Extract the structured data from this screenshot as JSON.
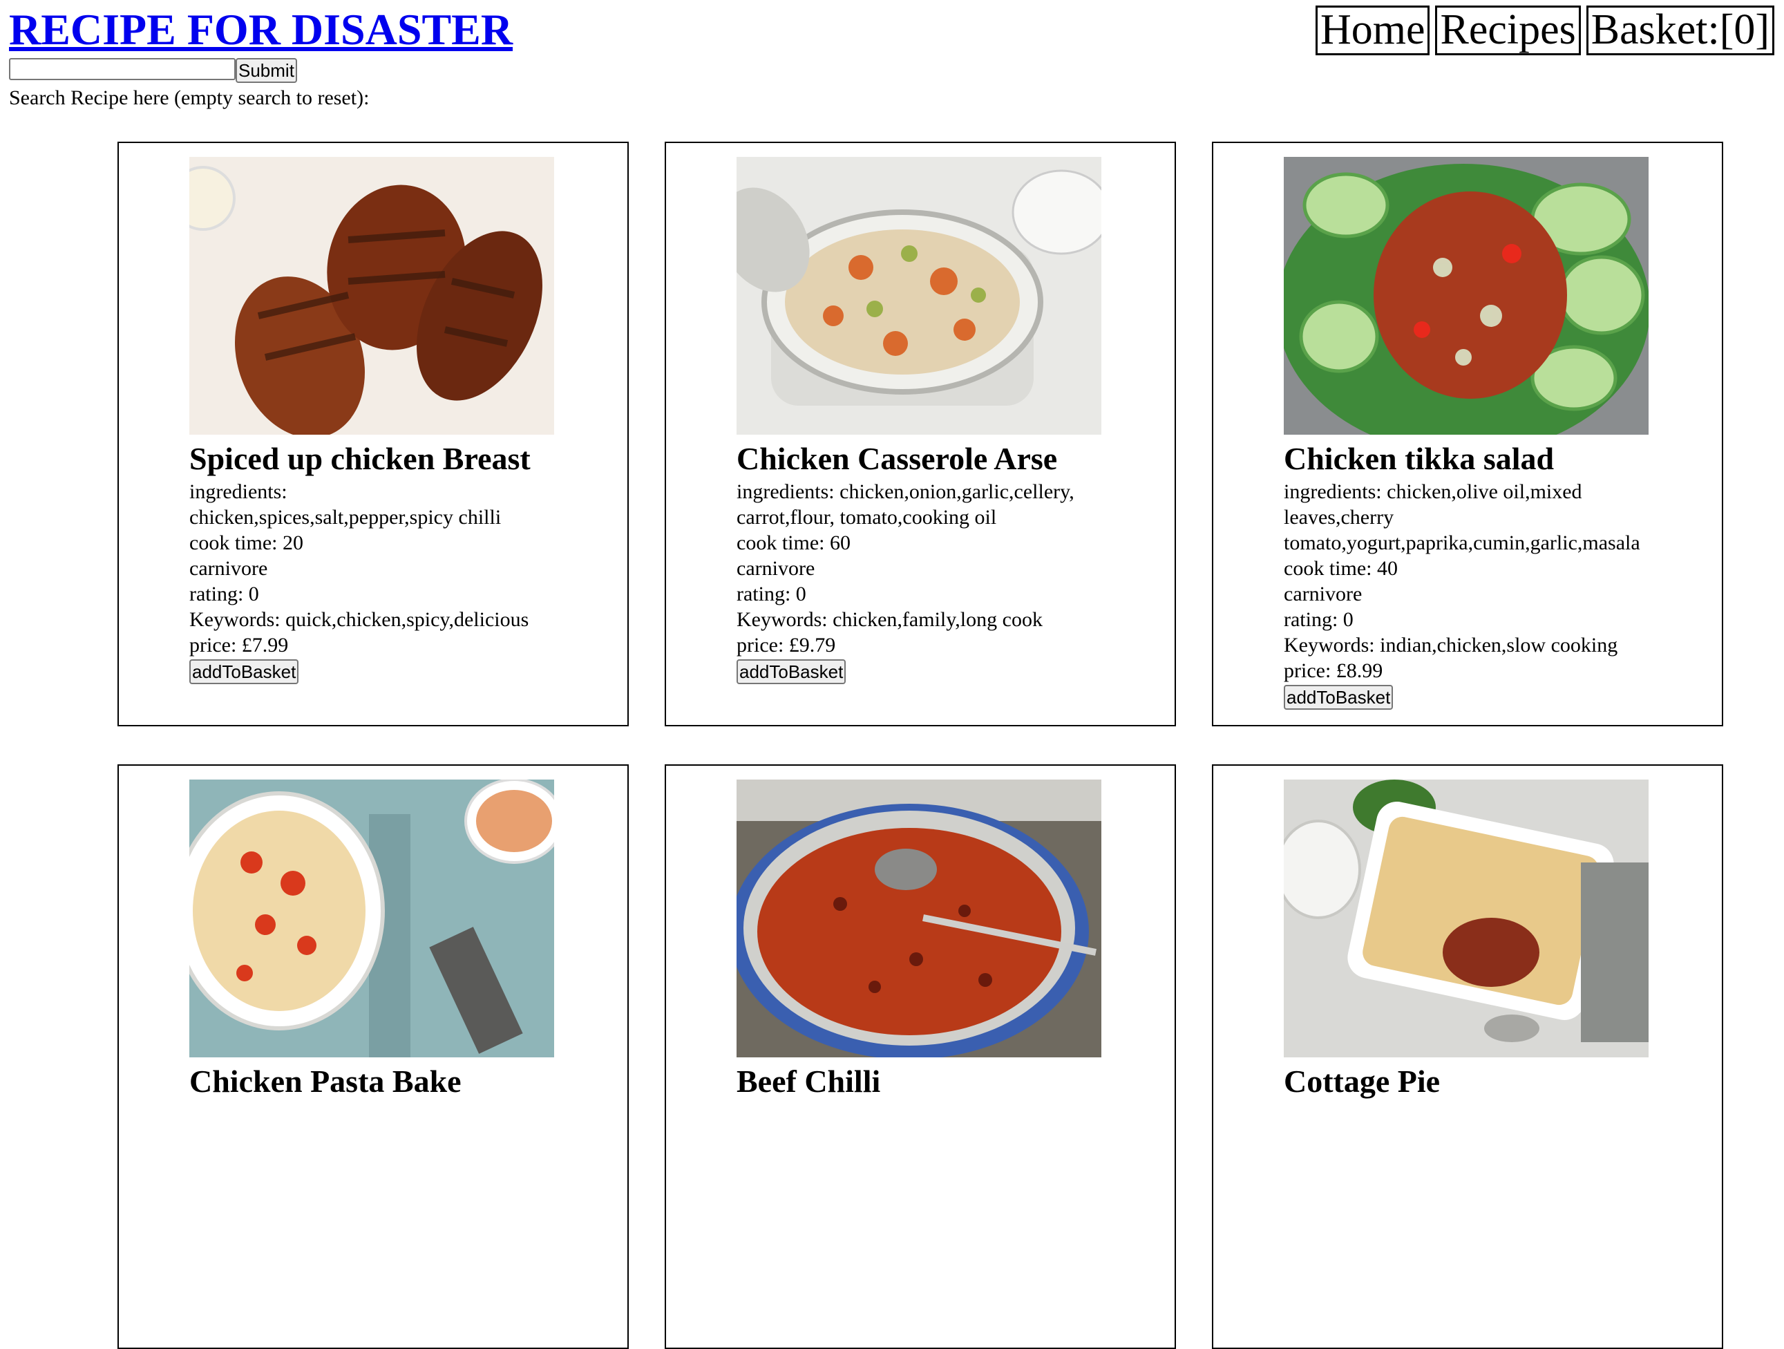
{
  "header": {
    "title": "RECIPE FOR DISASTER",
    "search": {
      "value": "",
      "placeholder": "",
      "submit_label": "Submit"
    },
    "search_hint": "Search Recipe here (empty search to reset):"
  },
  "nav": {
    "home": "Home",
    "recipes": "Recipes",
    "basket": "Basket:[0]"
  },
  "recipes": [
    {
      "name": "Spiced up chicken Breast",
      "ingredients": "ingredients: chicken,spices,salt,pepper,spicy chilli",
      "cook_time": "cook time: 20",
      "diet": "carnivore",
      "rating": "rating: 0",
      "keywords": "Keywords: quick,chicken,spicy,delicious",
      "price": "price: £7.99",
      "button_label": "addToBasket",
      "image": "grilled-chicken-breasts-photo",
      "image_colors": [
        "#f3ede6",
        "#8a3a18",
        "#3b1a0c"
      ]
    },
    {
      "name": "Chicken Casserole Arse",
      "ingredients": "ingredients: chicken,onion,garlic,cellery, carrot,flour, tomato,cooking oil",
      "cook_time": "cook time: 60",
      "diet": "carnivore",
      "rating": "rating: 0",
      "keywords": "Keywords: chicken,family,long cook",
      "price": "price: £9.79",
      "button_label": "addToBasket",
      "image": "chicken-casserole-pot-photo",
      "image_colors": [
        "#e9e9e6",
        "#e3d2b1",
        "#d96a2e"
      ]
    },
    {
      "name": "Chicken tikka salad",
      "ingredients": "ingredients: chicken,olive oil,mixed leaves,cherry tomato,yogurt,paprika,cumin,garlic,masala",
      "cook_time": "cook time: 40",
      "diet": "carnivore",
      "rating": "rating: 0",
      "keywords": "Keywords: indian,chicken,slow cooking",
      "price": "price: £8.99",
      "button_label": "addToBasket",
      "image": "chicken-tikka-salad-photo",
      "image_colors": [
        "#8a8d8f",
        "#3f8a3a",
        "#a83a1e"
      ]
    },
    {
      "name": "Chicken Pasta Bake",
      "image": "chicken-pasta-bake-photo",
      "image_colors": [
        "#8fb5b8",
        "#f0d9a8",
        "#d9391c"
      ]
    },
    {
      "name": "Beef Chilli",
      "image": "beef-chilli-pot-photo",
      "image_colors": [
        "#6f6a60",
        "#b83a18",
        "#3a5fb0"
      ]
    },
    {
      "name": "Cottage Pie",
      "image": "cottage-pie-dish-photo",
      "image_colors": [
        "#d9d9d6",
        "#e8c98a",
        "#8a2e1a"
      ]
    }
  ]
}
